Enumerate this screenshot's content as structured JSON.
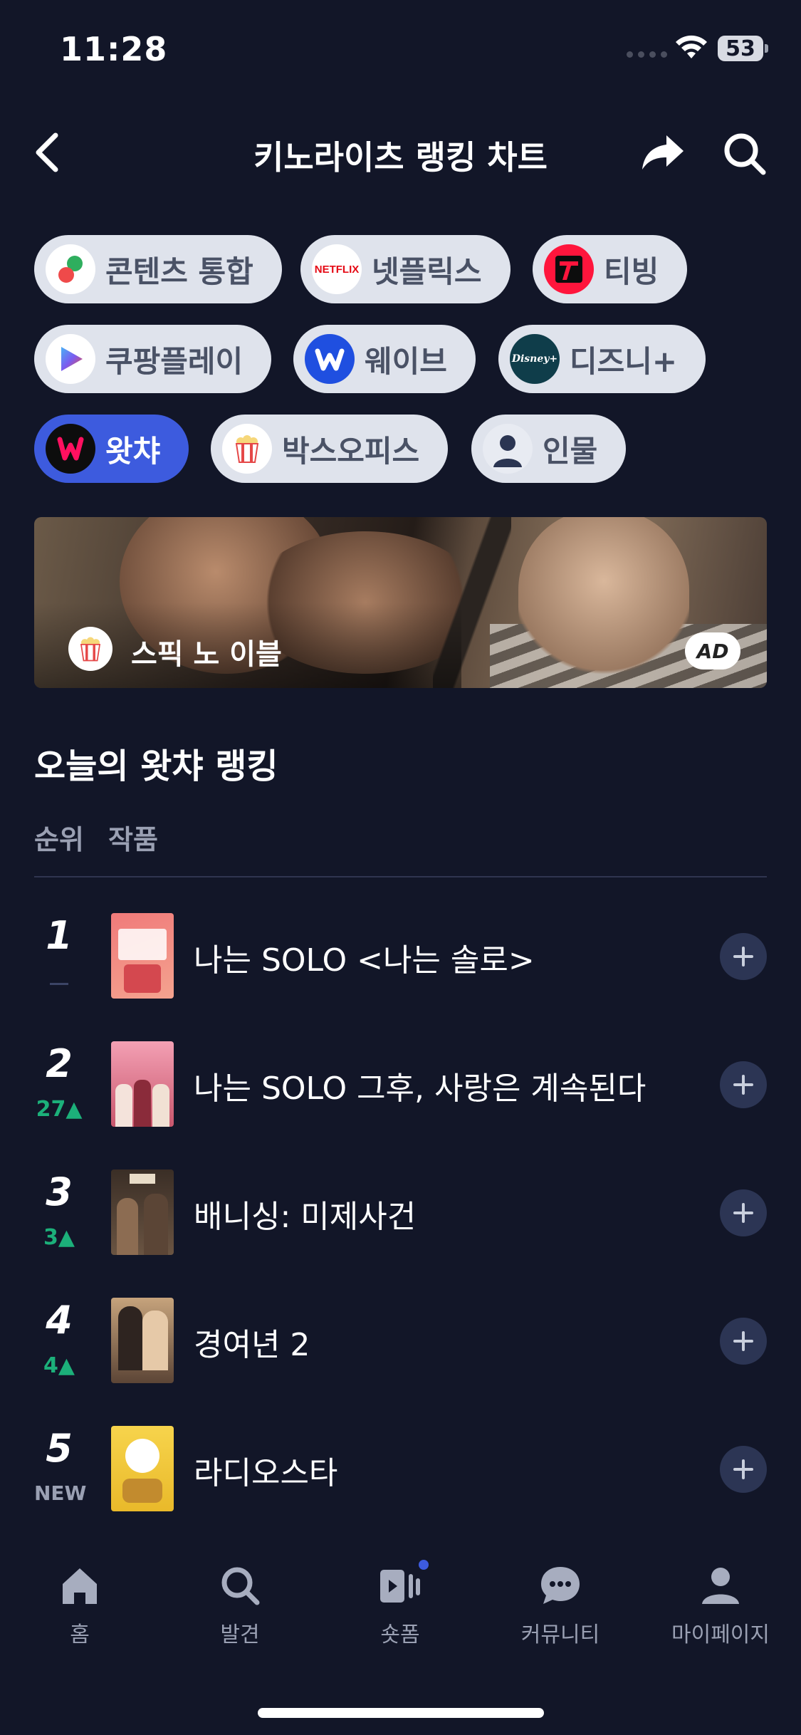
{
  "status_bar": {
    "time": "11:28",
    "battery": "53"
  },
  "header": {
    "title": "키노라이츠 랭킹 차트"
  },
  "chips": [
    {
      "label": "콘텐츠 통합",
      "icon": "kinolights-logo-icon"
    },
    {
      "label": "넷플릭스",
      "icon": "netflix-logo-icon",
      "icon_text": "NETFLIX"
    },
    {
      "label": "티빙",
      "icon": "tving-logo-icon"
    },
    {
      "label": "쿠팡플레이",
      "icon": "coupang-play-logo-icon"
    },
    {
      "label": "웨이브",
      "icon": "wavve-logo-icon"
    },
    {
      "label": "디즈니+",
      "icon": "disney-plus-logo-icon",
      "icon_text": "Disney+"
    },
    {
      "label": "왓챠",
      "icon": "watcha-logo-icon",
      "active": true
    },
    {
      "label": "박스오피스",
      "icon": "popcorn-icon"
    },
    {
      "label": "인물",
      "icon": "person-icon"
    }
  ],
  "banner": {
    "title": "스픽 노 이블",
    "badge": "AD"
  },
  "ranking": {
    "title": "오늘의 왓챠 랭킹",
    "col_rank": "순위",
    "col_title": "작품",
    "items": [
      {
        "rank": "1",
        "change": "",
        "change_type": "same",
        "title": "나는 SOLO <나는 솔로>",
        "poster_colors": [
          "#f07a7a",
          "#f4a38f"
        ]
      },
      {
        "rank": "2",
        "change": "27▲",
        "change_type": "up",
        "title": "나는 SOLO 그후, 사랑은 계속된다",
        "poster_colors": [
          "#f3a0b4",
          "#c9576d"
        ]
      },
      {
        "rank": "3",
        "change": "3▲",
        "change_type": "up",
        "title": "배니싱: 미제사건",
        "poster_colors": [
          "#3a2e26",
          "#6a5442"
        ]
      },
      {
        "rank": "4",
        "change": "4▲",
        "change_type": "up",
        "title": "경여년 2",
        "poster_colors": [
          "#c6a37c",
          "#5c4536"
        ]
      },
      {
        "rank": "5",
        "change": "NEW",
        "change_type": "new",
        "title": "라디오스타",
        "poster_colors": [
          "#f7d44c",
          "#e9b92a"
        ]
      }
    ]
  },
  "bottom_nav": [
    {
      "label": "홈",
      "icon": "home-icon"
    },
    {
      "label": "발견",
      "icon": "search-icon"
    },
    {
      "label": "숏폼",
      "icon": "shortform-icon"
    },
    {
      "label": "커뮤니티",
      "icon": "chat-bubble-icon"
    },
    {
      "label": "마이페이지",
      "icon": "profile-icon"
    }
  ],
  "colors": {
    "accent": "#3d5bde",
    "background": "#121628",
    "up": "#1cb07a"
  }
}
